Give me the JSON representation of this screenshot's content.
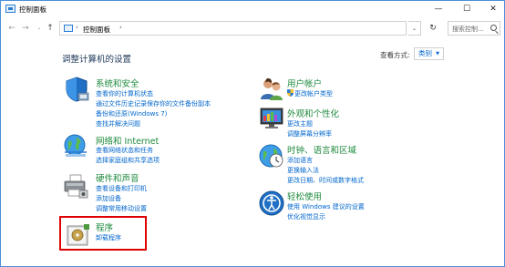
{
  "window": {
    "title": "控制面板",
    "minimize_glyph": "—",
    "maximize_glyph": "☐",
    "close_glyph": "✕"
  },
  "nav": {
    "back_glyph": "←",
    "forward_glyph": "→",
    "recent_glyph": "⌄",
    "up_glyph": "↑",
    "address_sep": "›",
    "address_text": "控制面板",
    "address_dropdown_glyph": "⌄",
    "refresh_glyph": "↻",
    "search_placeholder": "搜索控制..."
  },
  "main": {
    "heading": "调整计算机的设置",
    "view_by_label": "查看方式:",
    "view_by_value": "类别",
    "view_by_caret": "▼"
  },
  "categories": {
    "system_security": {
      "title": "系统和安全",
      "links": [
        "查看你的计算机状态",
        "通过文件历史记录保存你的文件备份副本",
        "备份和还原(Windows 7)",
        "查找并解决问题"
      ]
    },
    "network": {
      "title": "网络和 Internet",
      "links": [
        "查看网络状态和任务",
        "选择家庭组和共享选项"
      ]
    },
    "hardware": {
      "title": "硬件和声音",
      "links": [
        "查看设备和打印机",
        "添加设备",
        "调整常用移动设置"
      ]
    },
    "programs": {
      "title": "程序",
      "links": [
        "卸载程序"
      ]
    },
    "user_accounts": {
      "title": "用户帐户",
      "links": [
        "更改帐户类型"
      ]
    },
    "appearance": {
      "title": "外观和个性化",
      "links": [
        "更改主题",
        "调整屏幕分辨率"
      ]
    },
    "clock": {
      "title": "时钟、语言和区域",
      "links": [
        "添加语言",
        "更换输入法",
        "更改日期、时间或数字格式"
      ]
    },
    "ease": {
      "title": "轻松使用",
      "links": [
        "使用 Windows 建议的设置",
        "优化视觉显示"
      ]
    }
  },
  "colors": {
    "category_title": "#1e8a3d",
    "link": "#0066cc",
    "heading": "#1e395b",
    "highlight": "#e00000"
  },
  "icons": {
    "system_security": "shield-icon",
    "network": "globe-icon",
    "hardware": "printer-icon",
    "programs": "program-box-icon",
    "user_accounts": "users-icon",
    "appearance": "monitor-palette-icon",
    "clock": "clock-globe-icon",
    "ease": "accessibility-icon"
  }
}
